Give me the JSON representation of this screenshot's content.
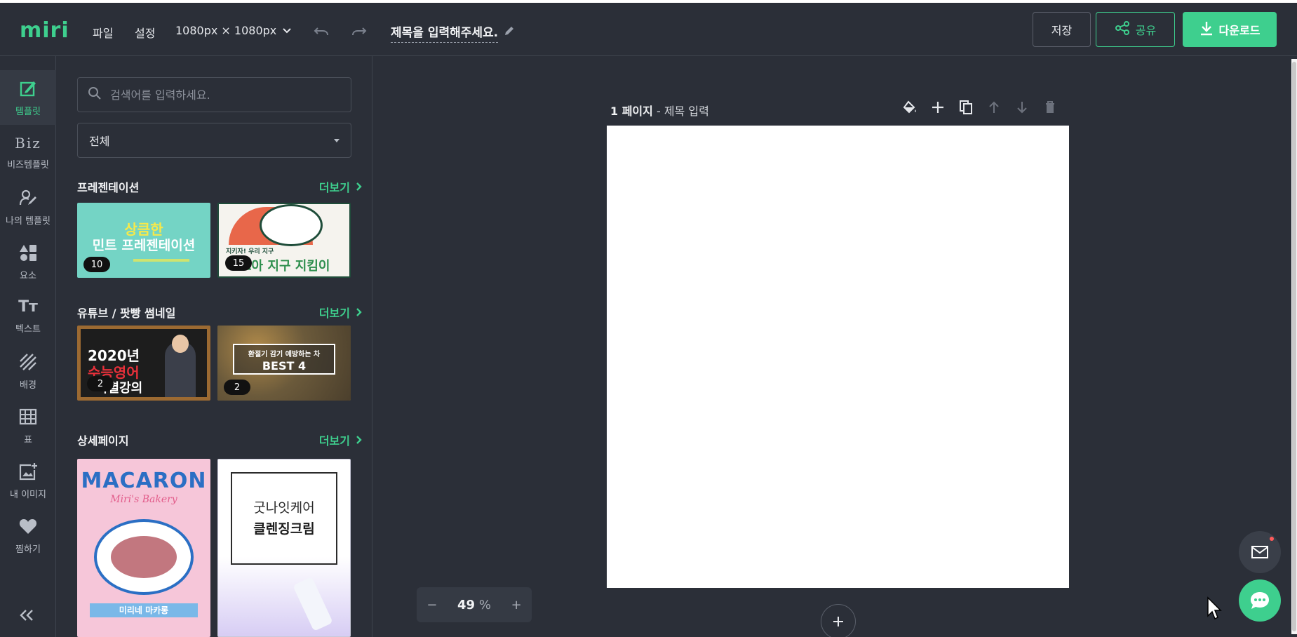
{
  "app": {
    "logo": "miri",
    "accent": "#3ecf8e"
  },
  "topbar": {
    "menu_file": "파일",
    "menu_settings": "설정",
    "canvas_size": "1080px × 1080px",
    "doc_title": "제목을 입력해주세요.",
    "save": "저장",
    "share": "공유",
    "download": "다운로드"
  },
  "sidebar": {
    "items": [
      {
        "label": "템플릿",
        "icon": "template-edit-icon"
      },
      {
        "label": "비즈템플릿",
        "icon": "biz-icon",
        "icon_text": "Biz"
      },
      {
        "label": "나의 템플릿",
        "icon": "my-template-icon"
      },
      {
        "label": "요소",
        "icon": "shapes-icon"
      },
      {
        "label": "텍스트",
        "icon": "text-icon",
        "icon_text": "Tт"
      },
      {
        "label": "배경",
        "icon": "background-icon"
      },
      {
        "label": "표",
        "icon": "table-icon"
      },
      {
        "label": "내 이미지",
        "icon": "my-image-icon"
      },
      {
        "label": "찜하기",
        "icon": "heart-icon"
      }
    ]
  },
  "panel": {
    "search_placeholder": "검색어를 입력하세요.",
    "category": "전체",
    "more_label": "더보기",
    "sections": [
      {
        "title": "프레젠테이션",
        "items": [
          {
            "badge": "10",
            "lines": [
              "상큼한",
              "민트 프레젠테이션"
            ]
          },
          {
            "badge": "15",
            "lines": [
              "지키자! 우리 지구",
              "초아 지구 지킴이"
            ]
          }
        ]
      },
      {
        "title": "유튜브 / 팟빵 썸네일",
        "items": [
          {
            "badge": "2",
            "lines": [
              "2020년",
              "수능영어",
              "특별강의"
            ]
          },
          {
            "badge": "2",
            "lines": [
              "환절기 감기 예방하는 차",
              "BEST 4"
            ]
          }
        ]
      },
      {
        "title": "상세페이지",
        "items": [
          {
            "lines": [
              "MACARON",
              "Miri's Bakery",
              "미리네 마카롱"
            ]
          },
          {
            "lines": [
              "굿나잇케어",
              "클렌징크림"
            ]
          }
        ]
      }
    ]
  },
  "stage": {
    "page_number": "1 페이지",
    "page_title": "- 제목 입력",
    "zoom": "49",
    "zoom_unit": "%"
  }
}
